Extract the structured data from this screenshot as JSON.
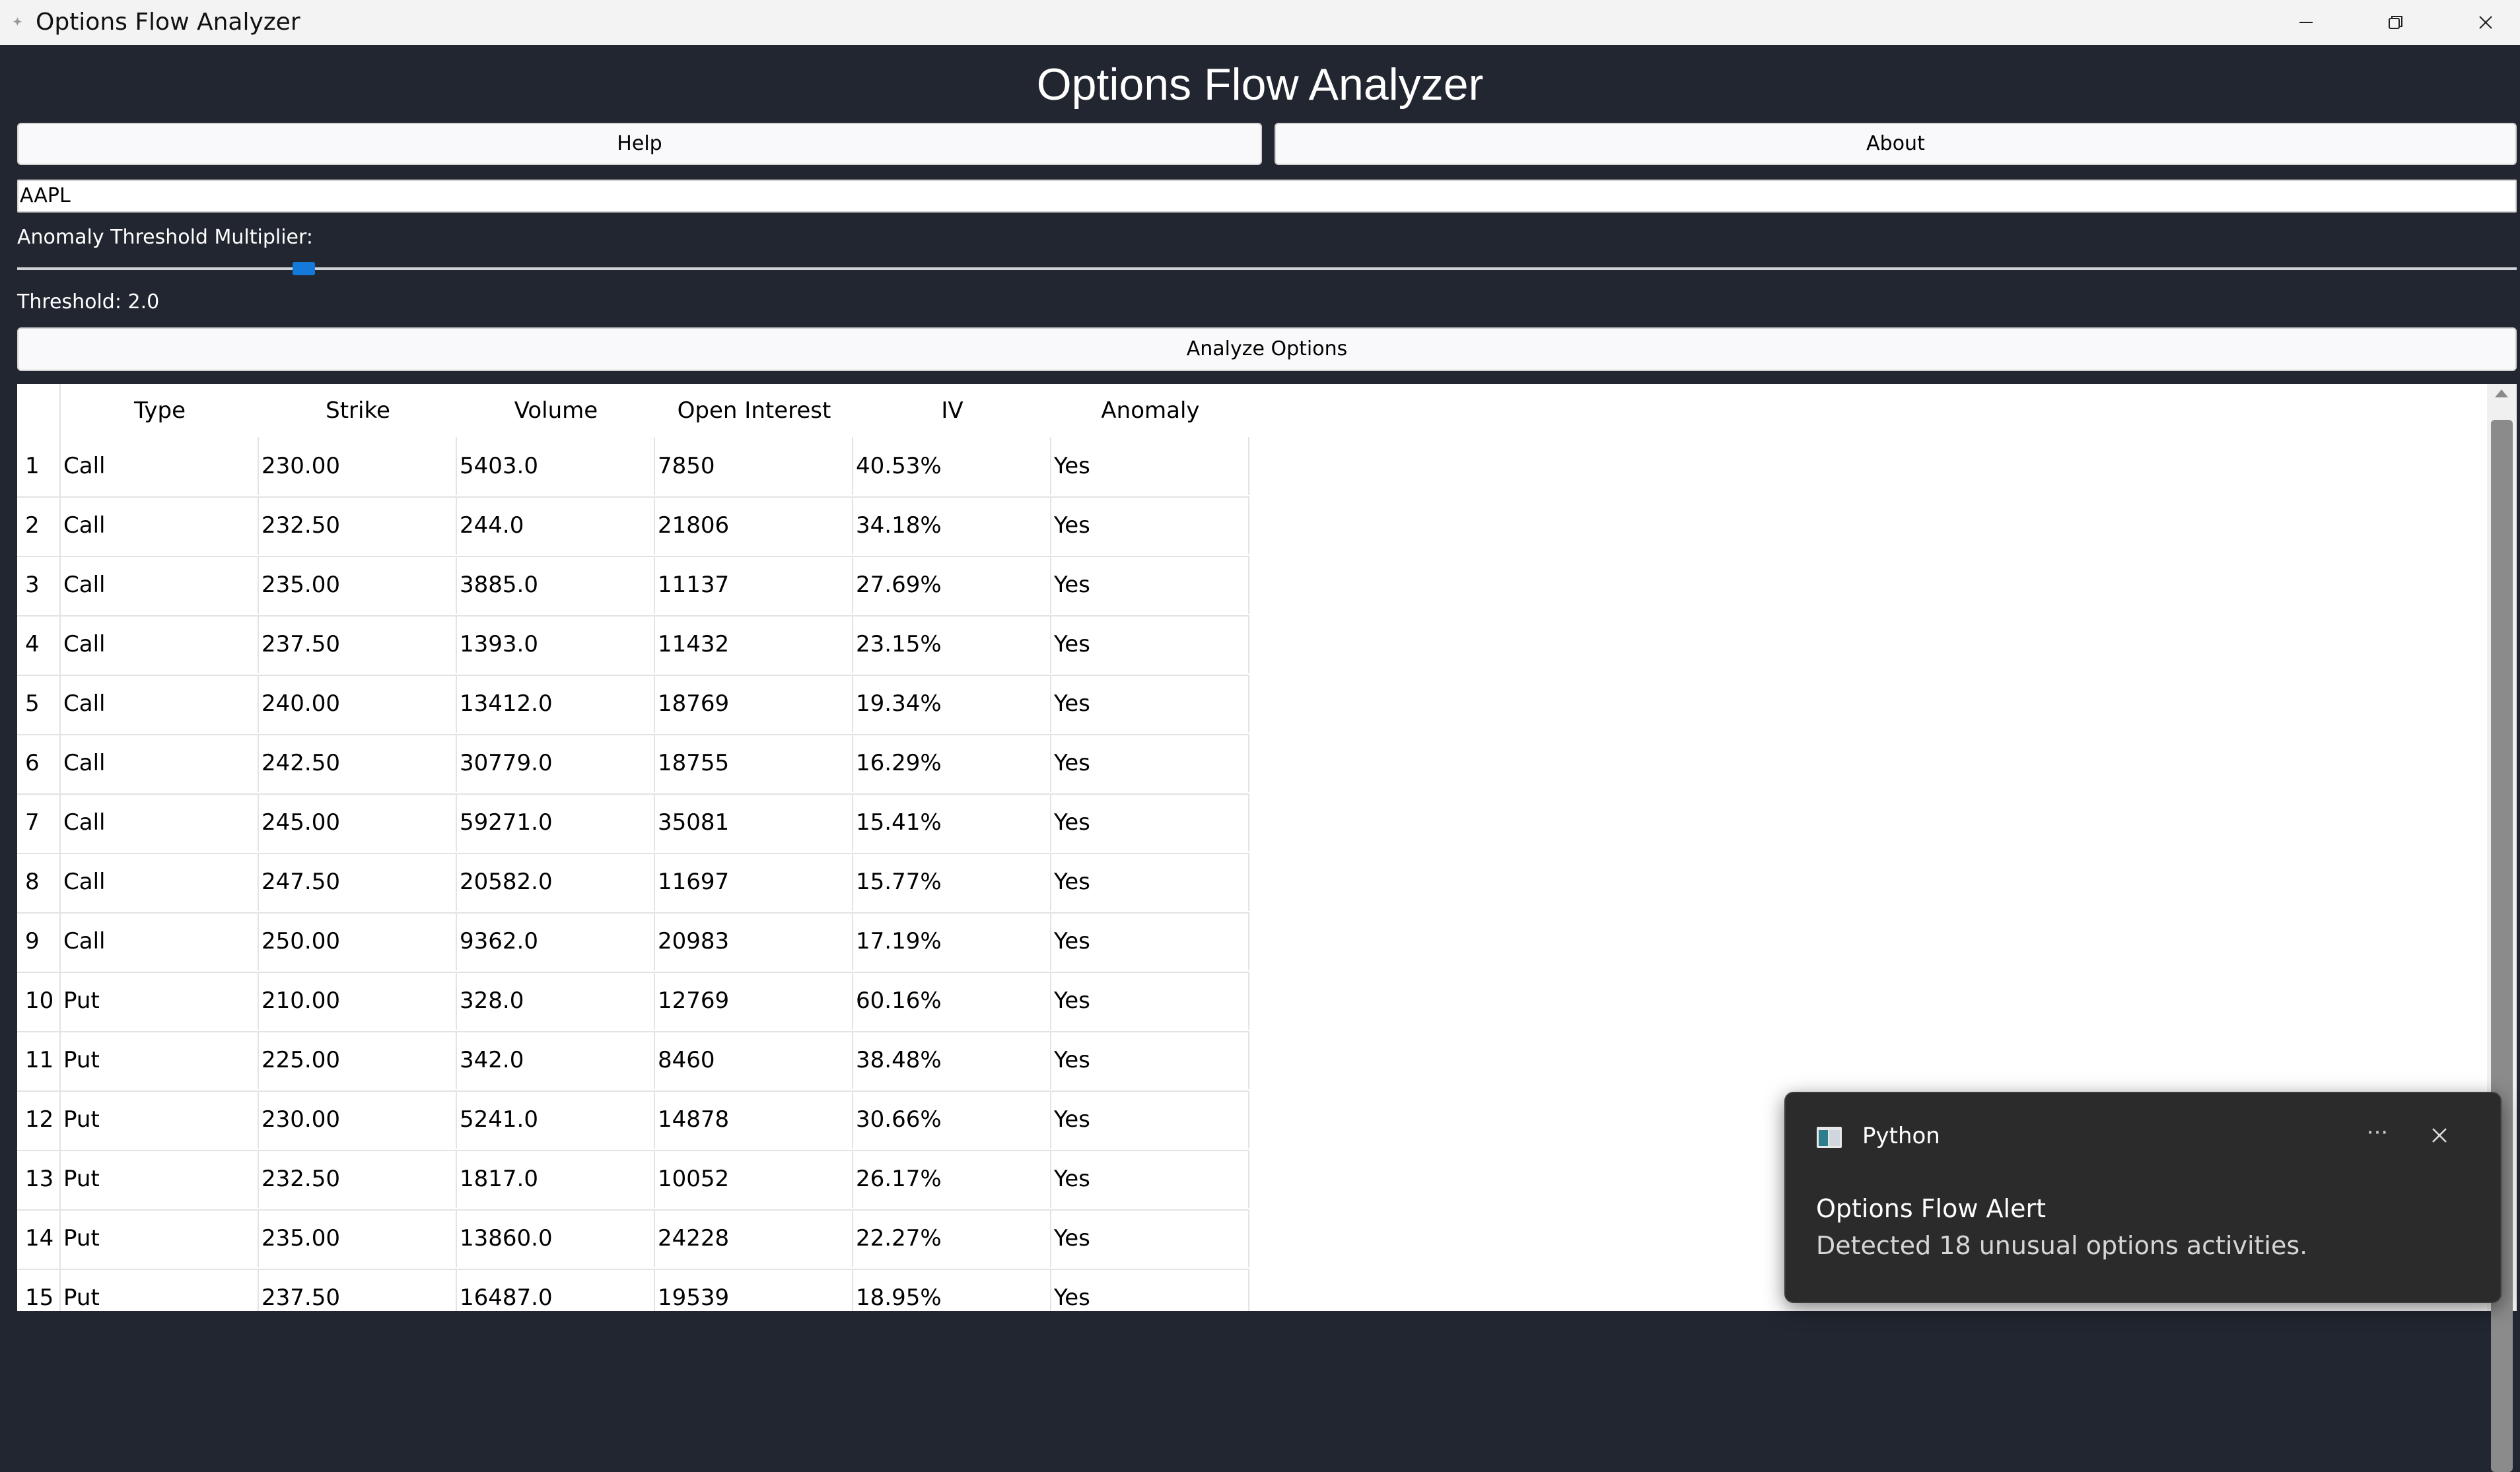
{
  "window": {
    "title": "Options Flow Analyzer"
  },
  "header": {
    "title": "Options Flow Analyzer",
    "help_label": "Help",
    "about_label": "About"
  },
  "controls": {
    "ticker_value": "AAPL",
    "threshold_label": "Anomaly Threshold Multiplier:",
    "threshold_value_text": "Threshold: 2.0",
    "slider_value": 2.0,
    "analyze_label": "Analyze Options"
  },
  "table": {
    "columns": [
      "Type",
      "Strike",
      "Volume",
      "Open Interest",
      "IV",
      "Anomaly"
    ],
    "rows": [
      {
        "index": "1",
        "type": "Call",
        "strike": "230.00",
        "volume": "5403.0",
        "open_interest": "7850",
        "iv": "40.53%",
        "anomaly": "Yes"
      },
      {
        "index": "2",
        "type": "Call",
        "strike": "232.50",
        "volume": "244.0",
        "open_interest": "21806",
        "iv": "34.18%",
        "anomaly": "Yes"
      },
      {
        "index": "3",
        "type": "Call",
        "strike": "235.00",
        "volume": "3885.0",
        "open_interest": "11137",
        "iv": "27.69%",
        "anomaly": "Yes"
      },
      {
        "index": "4",
        "type": "Call",
        "strike": "237.50",
        "volume": "1393.0",
        "open_interest": "11432",
        "iv": "23.15%",
        "anomaly": "Yes"
      },
      {
        "index": "5",
        "type": "Call",
        "strike": "240.00",
        "volume": "13412.0",
        "open_interest": "18769",
        "iv": "19.34%",
        "anomaly": "Yes"
      },
      {
        "index": "6",
        "type": "Call",
        "strike": "242.50",
        "volume": "30779.0",
        "open_interest": "18755",
        "iv": "16.29%",
        "anomaly": "Yes"
      },
      {
        "index": "7",
        "type": "Call",
        "strike": "245.00",
        "volume": "59271.0",
        "open_interest": "35081",
        "iv": "15.41%",
        "anomaly": "Yes"
      },
      {
        "index": "8",
        "type": "Call",
        "strike": "247.50",
        "volume": "20582.0",
        "open_interest": "11697",
        "iv": "15.77%",
        "anomaly": "Yes"
      },
      {
        "index": "9",
        "type": "Call",
        "strike": "250.00",
        "volume": "9362.0",
        "open_interest": "20983",
        "iv": "17.19%",
        "anomaly": "Yes"
      },
      {
        "index": "10",
        "type": "Put",
        "strike": "210.00",
        "volume": "328.0",
        "open_interest": "12769",
        "iv": "60.16%",
        "anomaly": "Yes"
      },
      {
        "index": "11",
        "type": "Put",
        "strike": "225.00",
        "volume": "342.0",
        "open_interest": "8460",
        "iv": "38.48%",
        "anomaly": "Yes"
      },
      {
        "index": "12",
        "type": "Put",
        "strike": "230.00",
        "volume": "5241.0",
        "open_interest": "14878",
        "iv": "30.66%",
        "anomaly": "Yes"
      },
      {
        "index": "13",
        "type": "Put",
        "strike": "232.50",
        "volume": "1817.0",
        "open_interest": "10052",
        "iv": "26.17%",
        "anomaly": "Yes"
      },
      {
        "index": "14",
        "type": "Put",
        "strike": "235.00",
        "volume": "13860.0",
        "open_interest": "24228",
        "iv": "22.27%",
        "anomaly": "Yes"
      },
      {
        "index": "15",
        "type": "Put",
        "strike": "237.50",
        "volume": "16487.0",
        "open_interest": "19539",
        "iv": "18.95%",
        "anomaly": "Yes"
      }
    ]
  },
  "notification": {
    "app_name": "Python",
    "more_label": "···",
    "title": "Options Flow Alert",
    "message": "Detected 18 unusual options activities."
  },
  "icons": {
    "app": "feather-icon",
    "minimize": "minimize-icon",
    "maximize": "restore-icon",
    "close": "close-icon",
    "notification_app": "python-app-icon",
    "notification_more": "more-icon",
    "notification_close": "close-icon"
  },
  "colors": {
    "background": "#212630",
    "slider_handle": "#1479d8",
    "toast_background": "#2b2b2b"
  }
}
